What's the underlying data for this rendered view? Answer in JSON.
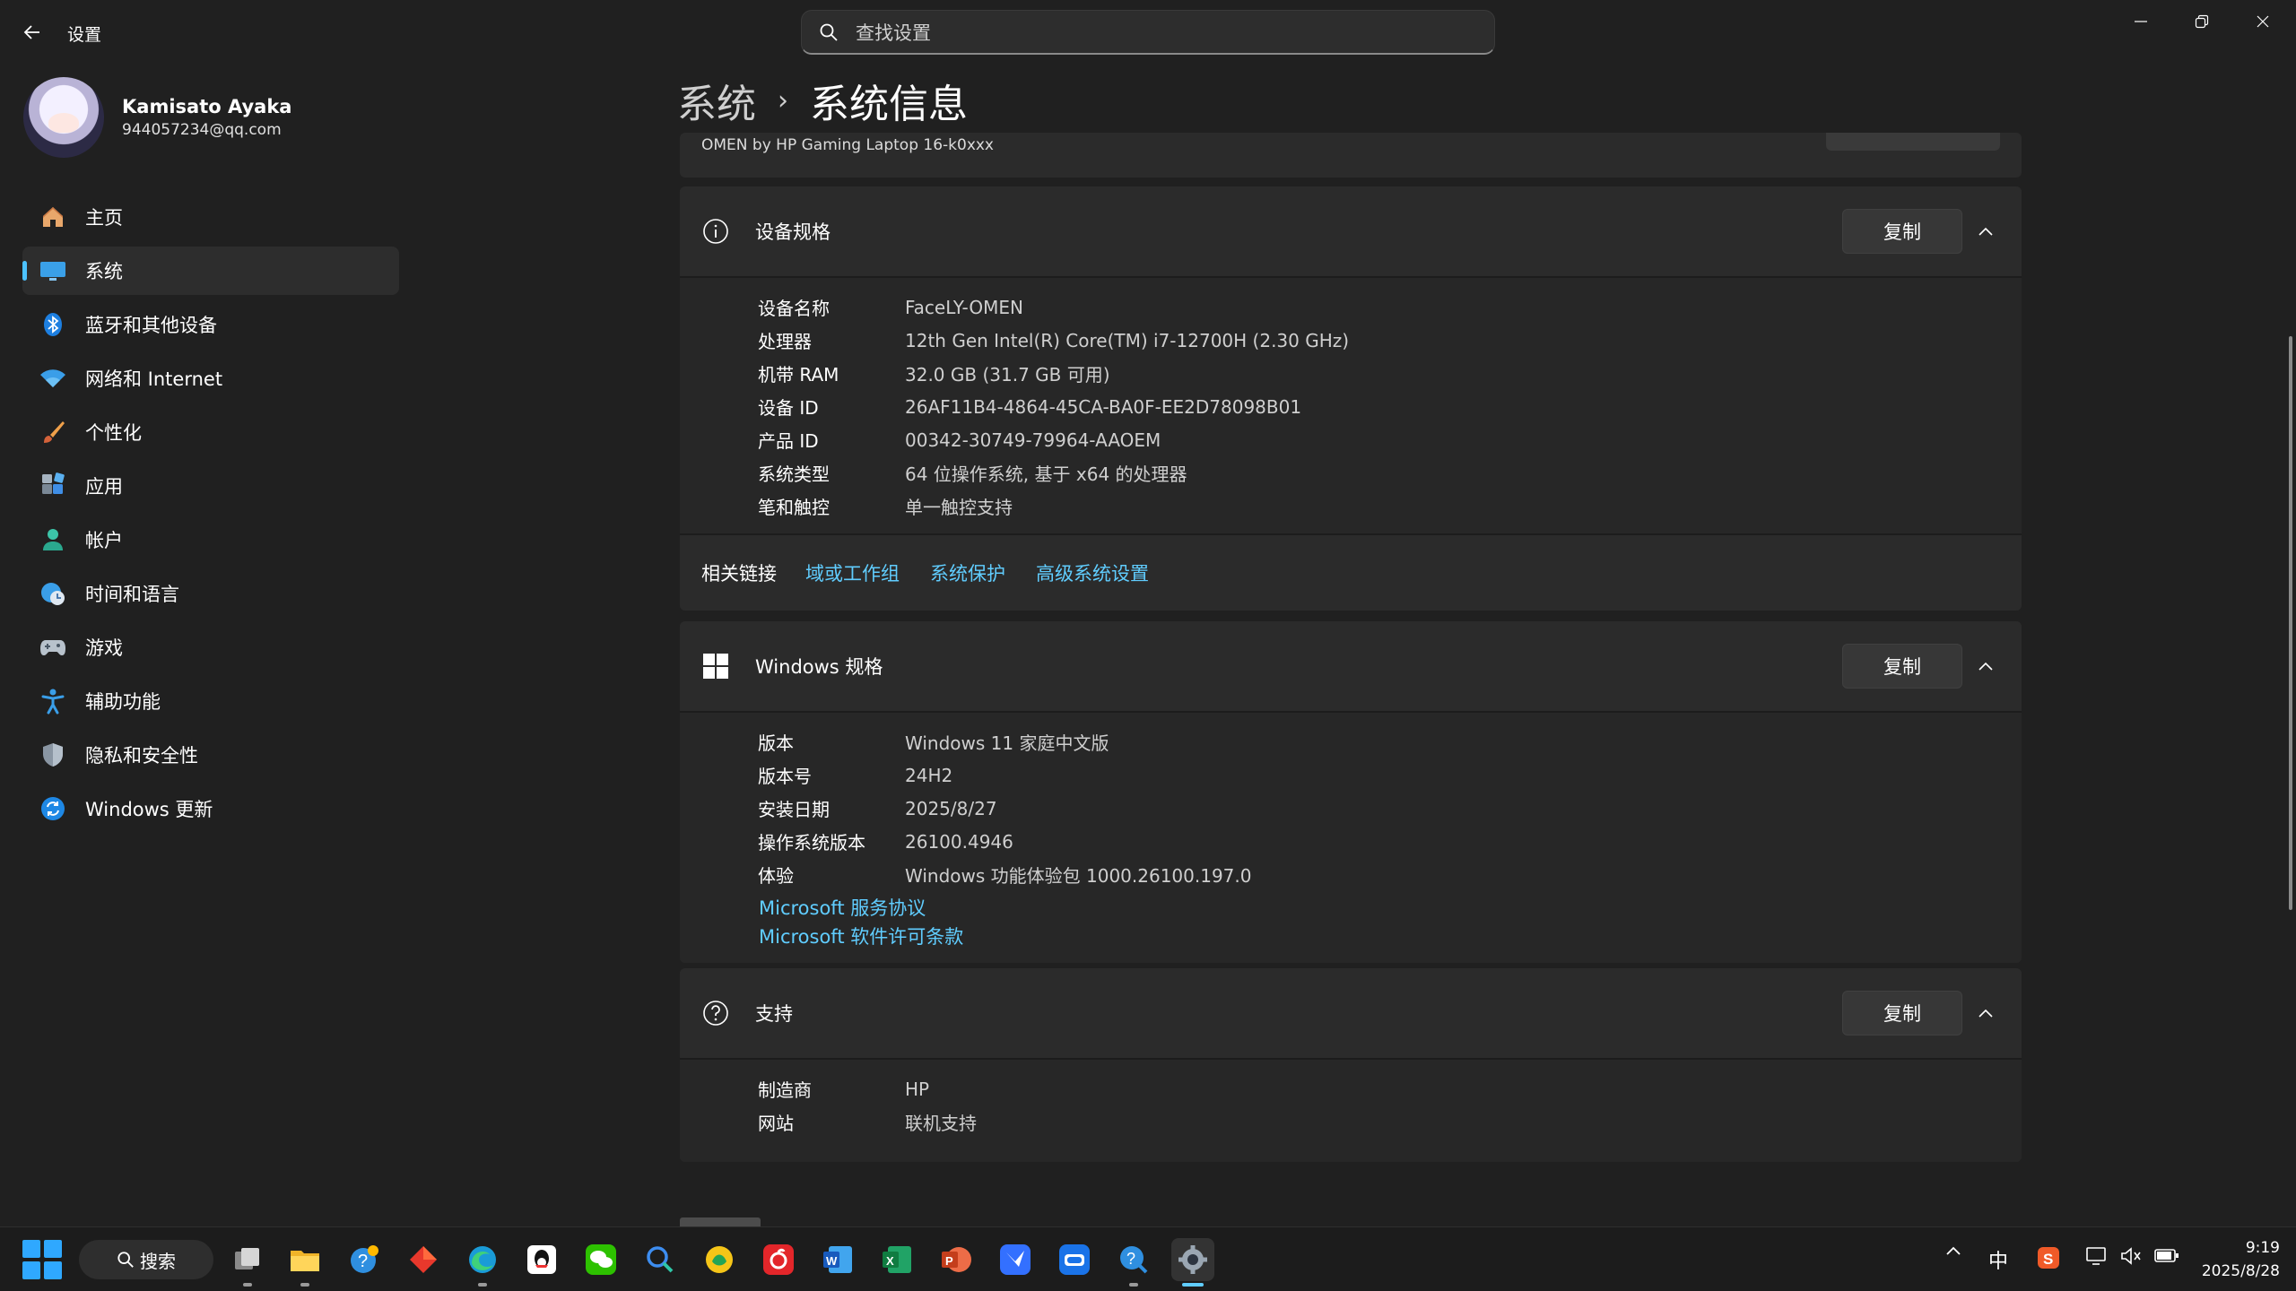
{
  "window": {
    "title": "设置",
    "search_placeholder": "查找设置"
  },
  "profile": {
    "name": "Kamisato Ayaka",
    "email": "944057234@qq.com"
  },
  "nav": [
    {
      "label": "主页",
      "icon": "home-icon"
    },
    {
      "label": "系统",
      "icon": "monitor-icon",
      "active": true
    },
    {
      "label": "蓝牙和其他设备",
      "icon": "bluetooth-icon"
    },
    {
      "label": "网络和 Internet",
      "icon": "wifi-icon"
    },
    {
      "label": "个性化",
      "icon": "brush-icon"
    },
    {
      "label": "应用",
      "icon": "apps-icon"
    },
    {
      "label": "帐户",
      "icon": "person-icon"
    },
    {
      "label": "时间和语言",
      "icon": "globe-clock-icon"
    },
    {
      "label": "游戏",
      "icon": "gamepad-icon"
    },
    {
      "label": "辅助功能",
      "icon": "accessibility-icon"
    },
    {
      "label": "隐私和安全性",
      "icon": "shield-icon"
    },
    {
      "label": "Windows 更新",
      "icon": "update-icon"
    }
  ],
  "breadcrumb": {
    "parent": "系统",
    "current": "系统信息"
  },
  "top_card": {
    "model": "OMEN by HP Gaming Laptop 16-k0xxx"
  },
  "device_specs": {
    "title": "设备规格",
    "copy_label": "复制",
    "rows": [
      {
        "key": "设备名称",
        "value": "FaceLY-OMEN"
      },
      {
        "key": "处理器",
        "value": "12th Gen Intel(R) Core(TM) i7-12700H (2.30 GHz)"
      },
      {
        "key": "机带 RAM",
        "value": "32.0 GB (31.7 GB 可用)"
      },
      {
        "key": "设备 ID",
        "value": "26AF11B4-4864-45CA-BA0F-EE2D78098B01"
      },
      {
        "key": "产品 ID",
        "value": "00342-30749-79964-AAOEM"
      },
      {
        "key": "系统类型",
        "value": "64 位操作系统, 基于 x64 的处理器"
      },
      {
        "key": "笔和触控",
        "value": "单一触控支持"
      }
    ]
  },
  "related_links": {
    "label": "相关链接",
    "links": [
      "域或工作组",
      "系统保护",
      "高级系统设置"
    ]
  },
  "windows_specs": {
    "title": "Windows 规格",
    "copy_label": "复制",
    "rows": [
      {
        "key": "版本",
        "value": "Windows 11 家庭中文版"
      },
      {
        "key": "版本号",
        "value": "24H2"
      },
      {
        "key": "安装日期",
        "value": "2025/8/27"
      },
      {
        "key": "操作系统版本",
        "value": "26100.4946"
      },
      {
        "key": "体验",
        "value": "Windows 功能体验包 1000.26100.197.0"
      }
    ],
    "links": [
      "Microsoft 服务协议",
      "Microsoft 软件许可条款"
    ]
  },
  "support": {
    "title": "支持",
    "copy_label": "复制",
    "rows": [
      {
        "key": "制造商",
        "value": "HP",
        "link": false
      },
      {
        "key": "网站",
        "value": "联机支持",
        "link": true
      }
    ]
  },
  "taskbar": {
    "search_label": "搜索",
    "ime": "中",
    "time": "9:19",
    "date": "2025/8/28",
    "apps": [
      "task-view-icon",
      "file-explorer-icon",
      "tips-icon",
      "red-diamond-app-icon",
      "edge-icon",
      "qq-icon",
      "wechat-icon",
      "chat-search-icon",
      "gold-app-icon",
      "netease-music-icon",
      "word-icon",
      "excel-icon",
      "powerpoint-icon",
      "feishu-icon",
      "meeting-icon",
      "help-icon",
      "settings-icon"
    ]
  },
  "colors": {
    "background": "#202020",
    "card": "#2b2b2b",
    "accent": "#4cc2ff",
    "link": "#60cdff"
  }
}
